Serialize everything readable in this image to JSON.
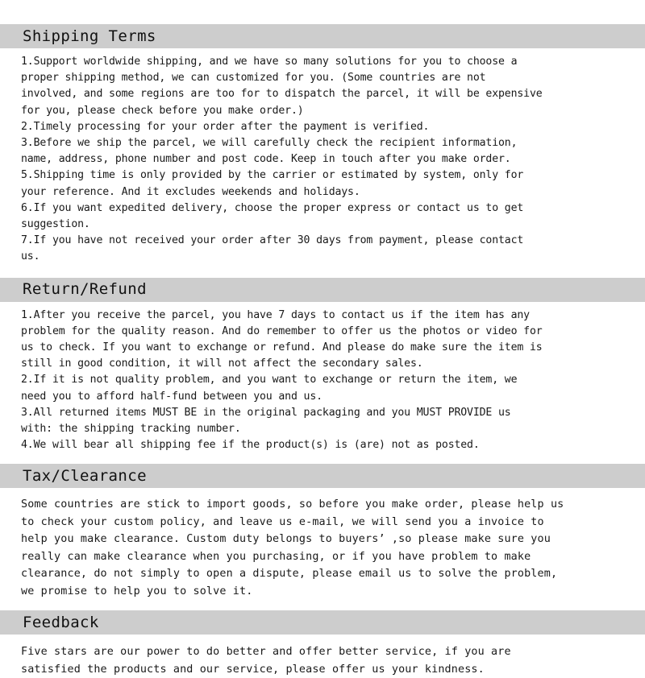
{
  "document": {
    "background_color": "#ffffff",
    "header_band_color": "#cdcdcd",
    "text_color": "#191919"
  },
  "sections": [
    {
      "id": "shipping",
      "title": "Shipping Terms",
      "lines": [
        "1.Support worldwide shipping, and we have so many solutions for you to choose a",
        "proper shipping method, we can customized for you. (Some countries are not",
        "involved, and some regions are too for to dispatch the parcel, it will be expensive",
        "for you, please check before you make order.)",
        "2.Timely processing for your order after the payment is verified.",
        "3.Before we ship the parcel, we will carefully check the recipient information,",
        "name, address, phone number and post code. Keep in touch after you make order.",
        "5.Shipping time is only provided by the carrier or estimated by system, only for",
        "your reference. And it excludes weekends and holidays.",
        "6.If you want expedited delivery, choose the proper express or contact us to get",
        "suggestion.",
        "7.If you have not received your order after 30 days from payment, please contact",
        "us."
      ]
    },
    {
      "id": "returns",
      "title": "Return/Refund",
      "lines": [
        "1.After you receive the parcel, you have 7 days to contact us if the item has any",
        "problem for the quality reason. And do remember to offer us the photos or video for",
        "us to check. If you want to exchange or refund. And please do make sure the item is",
        "still in good condition, it will not affect the secondary sales.",
        "2.If it is not quality problem, and you want to exchange or return the item, we",
        "need you to afford half-fund between you and us.",
        "3.All returned items MUST BE in the original packaging and you MUST PROVIDE us",
        "with: the shipping tracking number.",
        "4.We will bear all shipping fee if the product(s) is (are) not as posted."
      ]
    },
    {
      "id": "tax",
      "title": "Tax/Clearance",
      "lines": [
        "Some countries are stick to import goods, so before you make order, please help us",
        "to check your custom policy, and leave us e-mail, we will send you a invoice to",
        "help you make clearance. Custom duty belongs to buyers’ ,so please make sure you",
        "really can make clearance when you purchasing, or if you have problem to make",
        "clearance, do not simply to open a dispute, please email us to solve the problem,",
        "we promise to help you to solve it."
      ]
    },
    {
      "id": "feedback",
      "title": "Feedback",
      "lines": [
        "Five stars are our power to do better and offer better service, if you are",
        "satisfied the products and our service, please offer us your kindness."
      ]
    }
  ]
}
